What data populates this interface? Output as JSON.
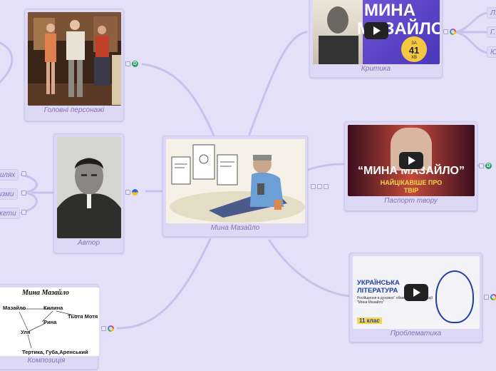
{
  "center": {
    "label": "Мина Мазайло"
  },
  "nodes": [
    {
      "id": "characters",
      "label": "Головні персонажі"
    },
    {
      "id": "author",
      "label": "Автор"
    },
    {
      "id": "composition",
      "label": "Композиція",
      "diagram": {
        "title": "Мина Мазайло",
        "names": [
          "Мазайло",
          "Килина",
          "Тьотя Мотя",
          "Рина",
          "Уля",
          "Тертика, Губа,Аренський"
        ]
      }
    },
    {
      "id": "criticism",
      "label": "Критика",
      "video": {
        "title_line1": "МИНА",
        "title_line2": "МАЗАЙЛО",
        "minutes": "41",
        "minutes_prefix": "ЗА",
        "minutes_unit": "ХВ"
      }
    },
    {
      "id": "passport",
      "label": "Паспорт твору",
      "video": {
        "title": "“МИНА МАЗАЙЛО”",
        "subtitle": "НАЙЦІКАВІШЕ ПРО",
        "subtitle2": "ТВІР"
      }
    },
    {
      "id": "problems",
      "label": "Проблематика",
      "video": {
        "title": "УКРАЇНСЬКА ЛІТЕРАТУРА",
        "description": "Російщення в духовно\" обмеженості в комедії \"Мина Мазайло\"",
        "grade": "11 клас"
      }
    }
  ],
  "left_partial": [
    "шлях",
    "изми",
    "жгти"
  ],
  "right_partial": [
    "Л.",
    "Г.",
    "Ю"
  ]
}
